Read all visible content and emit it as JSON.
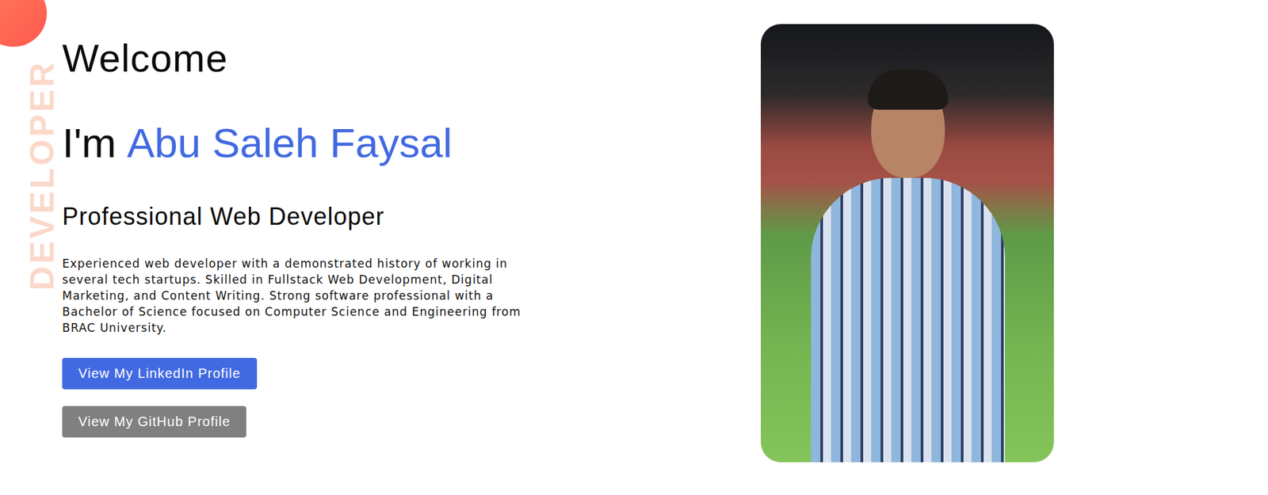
{
  "watermark": "DEVELOPER",
  "greeting": "Welcome",
  "intro": {
    "prefix": "I'm",
    "name": "Abu Saleh Faysal"
  },
  "role": "Professional Web Developer",
  "bio": "Experienced web developer with a demonstrated history of working in several tech startups. Skilled in Fullstack Web Development, Digital Marketing, and Content Writing. Strong software professional with a Bachelor of Science focused on Computer Science and Engineering from BRAC University.",
  "buttons": [
    {
      "label": "View My LinkedIn Profile",
      "kind": "primary"
    },
    {
      "label": "View My GitHub Profile",
      "kind": "secondary"
    }
  ]
}
